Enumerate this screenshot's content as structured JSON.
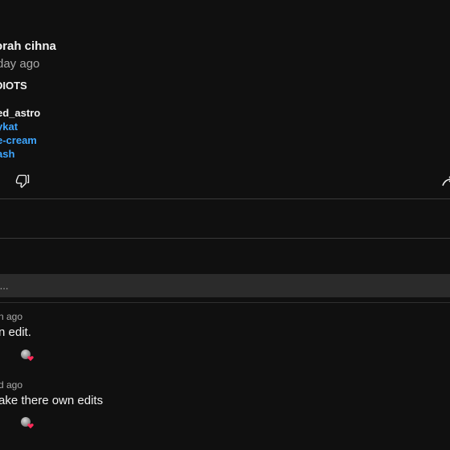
{
  "comment": {
    "author": "orah cihna",
    "time": "day ago",
    "text": "DIOTS",
    "mentions": [
      "ed_astro",
      "ykat",
      "e-cream",
      "ash"
    ]
  },
  "actions": {
    "dislike_icon": "thumbs-down-icon",
    "share_icon": "share-icon"
  },
  "composer": {
    "placeholder": "t..."
  },
  "replies": [
    {
      "time": "n ago",
      "text": "n edit.",
      "reaction_icon": "creator-heart-icon"
    },
    {
      "time": "d ago",
      "text": "ake there own edits",
      "reaction_icon": "creator-heart-icon"
    }
  ],
  "colors": {
    "background": "#101010",
    "link": "#3ea6ff",
    "heart": "#ff2b5a"
  }
}
